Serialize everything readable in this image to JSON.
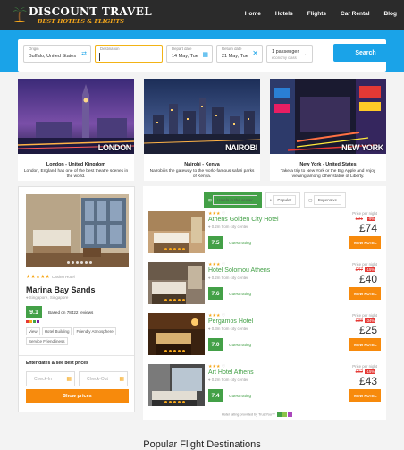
{
  "brand": {
    "name": "DISCOUNT TRAVEL",
    "tagline": "BEST HOTELS & FLIGHTS",
    "accent": "#f7a81b"
  },
  "nav": [
    "Home",
    "Hotels",
    "Flights",
    "Car Rental",
    "Blog"
  ],
  "search": {
    "origin": {
      "label": "Origin",
      "value": "Buffalo, United States"
    },
    "destination": {
      "label": "Destination",
      "value": ""
    },
    "depart": {
      "label": "Depart date",
      "value": "14 May, Tue"
    },
    "return": {
      "label": "Return date",
      "value": "21 May, Tue"
    },
    "passengers": {
      "value": "1 passenger",
      "class": "economy class"
    },
    "button": "Search"
  },
  "destinations": [
    {
      "city": "LONDON",
      "title": "London - United Kingdom",
      "desc": "London, England has one of the best theatre scenes in the world."
    },
    {
      "city": "NAIROBI",
      "title": "Nairobi - Kenya",
      "desc": "Nairobi is the gateway to the world-famous safari parks of Kenya."
    },
    {
      "city": "NEW YORK",
      "title": "New York - United States",
      "desc": "Take a trip to New York or the Big Apple and enjoy viewing among other statue of Liberty."
    }
  ],
  "featured": {
    "stars": "★★★★★",
    "type": "Casino Hotel",
    "name": "Marina Bay Sands",
    "location": "Singapore, Singapore",
    "score": "9.1",
    "reviews": "Based on 78422 reviews",
    "tags": [
      "View",
      "Hotel Building",
      "Friendly Atmosphere",
      "Service Friendliness"
    ],
    "enter": "Enter dates & see best prices",
    "checkin": "Check-In",
    "checkout": "Check-Out",
    "show": "Show prices"
  },
  "filters": [
    "Hotels in the center",
    "Popular",
    "Expensive"
  ],
  "results": [
    {
      "stars": "★★★",
      "name": "Athens Golden City Hotel",
      "dist": "0.2m from city center",
      "score": "7.5",
      "guest": "Guest rating",
      "ppn": "Price per night",
      "old": "£91",
      "pct": "-9%",
      "price": "£74",
      "btn": "VIEW HOTEL"
    },
    {
      "stars": "★★★",
      "name": "Hotel Solomou Athens",
      "dist": "0.2m from city center",
      "score": "7.6",
      "guest": "Guest rating",
      "ppn": "Price per night",
      "old": "£47",
      "pct": "-15%",
      "price": "£40",
      "btn": "VIEW HOTEL"
    },
    {
      "stars": "★★★",
      "name": "Pergamos Hotel",
      "dist": "0.3m from city center",
      "score": "7.0",
      "guest": "Guest rating",
      "ppn": "Price per night",
      "old": "£38",
      "pct": "-34%",
      "price": "£25",
      "btn": "VIEW HOTEL"
    },
    {
      "stars": "★★★",
      "name": "Art Hotel Athens",
      "dist": "0.2m from city center",
      "score": "7.4",
      "guest": "Guest rating",
      "ppn": "Price per night",
      "old": "£52",
      "pct": "-15%",
      "price": "£43",
      "btn": "VIEW HOTEL"
    }
  ],
  "provided": "Hotel rating provided by TrustYou™",
  "popular_heading": "Popular Flight Destinations"
}
